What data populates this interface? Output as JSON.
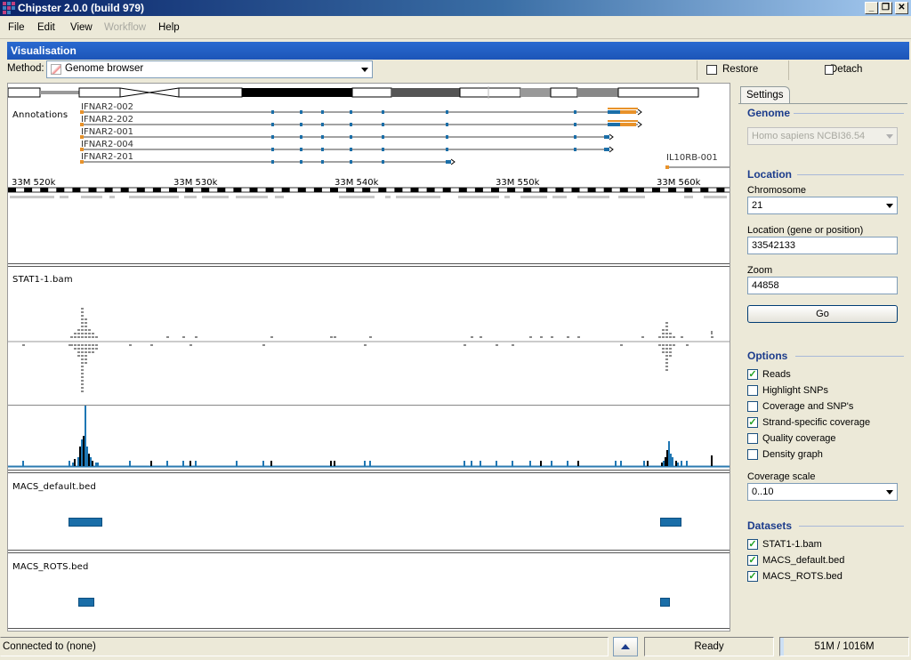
{
  "window": {
    "title": "Chipster 2.0.0 (build 979)"
  },
  "menu": [
    {
      "label": "File",
      "enabled": true
    },
    {
      "label": "Edit",
      "enabled": true
    },
    {
      "label": "View",
      "enabled": true
    },
    {
      "label": "Workflow",
      "enabled": false
    },
    {
      "label": "Help",
      "enabled": true
    }
  ],
  "panel": {
    "title": "Visualisation"
  },
  "method": {
    "label": "Method:",
    "value": "Genome browser"
  },
  "toolbar": {
    "restore": "Restore",
    "detach": "Detach"
  },
  "annotations": {
    "label": "Annotations",
    "genes": [
      "IFNAR2-002",
      "IFNAR2-202",
      "IFNAR2-001",
      "IFNAR2-004",
      "IFNAR2-201"
    ],
    "other_gene": "IL10RB-001"
  },
  "ruler": {
    "ticks": [
      "33M 520k",
      "33M 530k",
      "33M 540k",
      "33M 550k",
      "33M 560k"
    ]
  },
  "tracks": {
    "bam": "STAT1-1.bam",
    "macs_default": "MACS_default.bed",
    "macs_rots": "MACS_ROTS.bed"
  },
  "colors": {
    "peak": "#1f77b4",
    "read": "#8a8a8a",
    "exon": "#e8922a",
    "accent": "#1c3c8c"
  },
  "settings": {
    "tab": "Settings",
    "genome": {
      "header": "Genome",
      "value": "Homo sapiens NCBI36.54"
    },
    "location": {
      "header": "Location",
      "chromosome_label": "Chromosome",
      "chromosome": "21",
      "position_label": "Location (gene or position)",
      "position": "33542133",
      "zoom_label": "Zoom",
      "zoom": "44858",
      "go": "Go"
    },
    "options": {
      "header": "Options",
      "items": [
        {
          "label": "Reads",
          "checked": true
        },
        {
          "label": "Highlight SNPs",
          "checked": false
        },
        {
          "label": "Coverage and SNP's",
          "checked": false
        },
        {
          "label": "Strand-specific coverage",
          "checked": true
        },
        {
          "label": "Quality coverage",
          "checked": false
        },
        {
          "label": "Density graph",
          "checked": false
        }
      ],
      "coverage_scale_label": "Coverage scale",
      "coverage_scale": "0..10"
    },
    "datasets": {
      "header": "Datasets",
      "items": [
        {
          "label": "STAT1-1.bam",
          "checked": true
        },
        {
          "label": "MACS_default.bed",
          "checked": true
        },
        {
          "label": "MACS_ROTS.bed",
          "checked": true
        }
      ]
    }
  },
  "status": {
    "connection": "Connected to (none)",
    "state": "Ready",
    "memory": "51M / 1016M"
  }
}
